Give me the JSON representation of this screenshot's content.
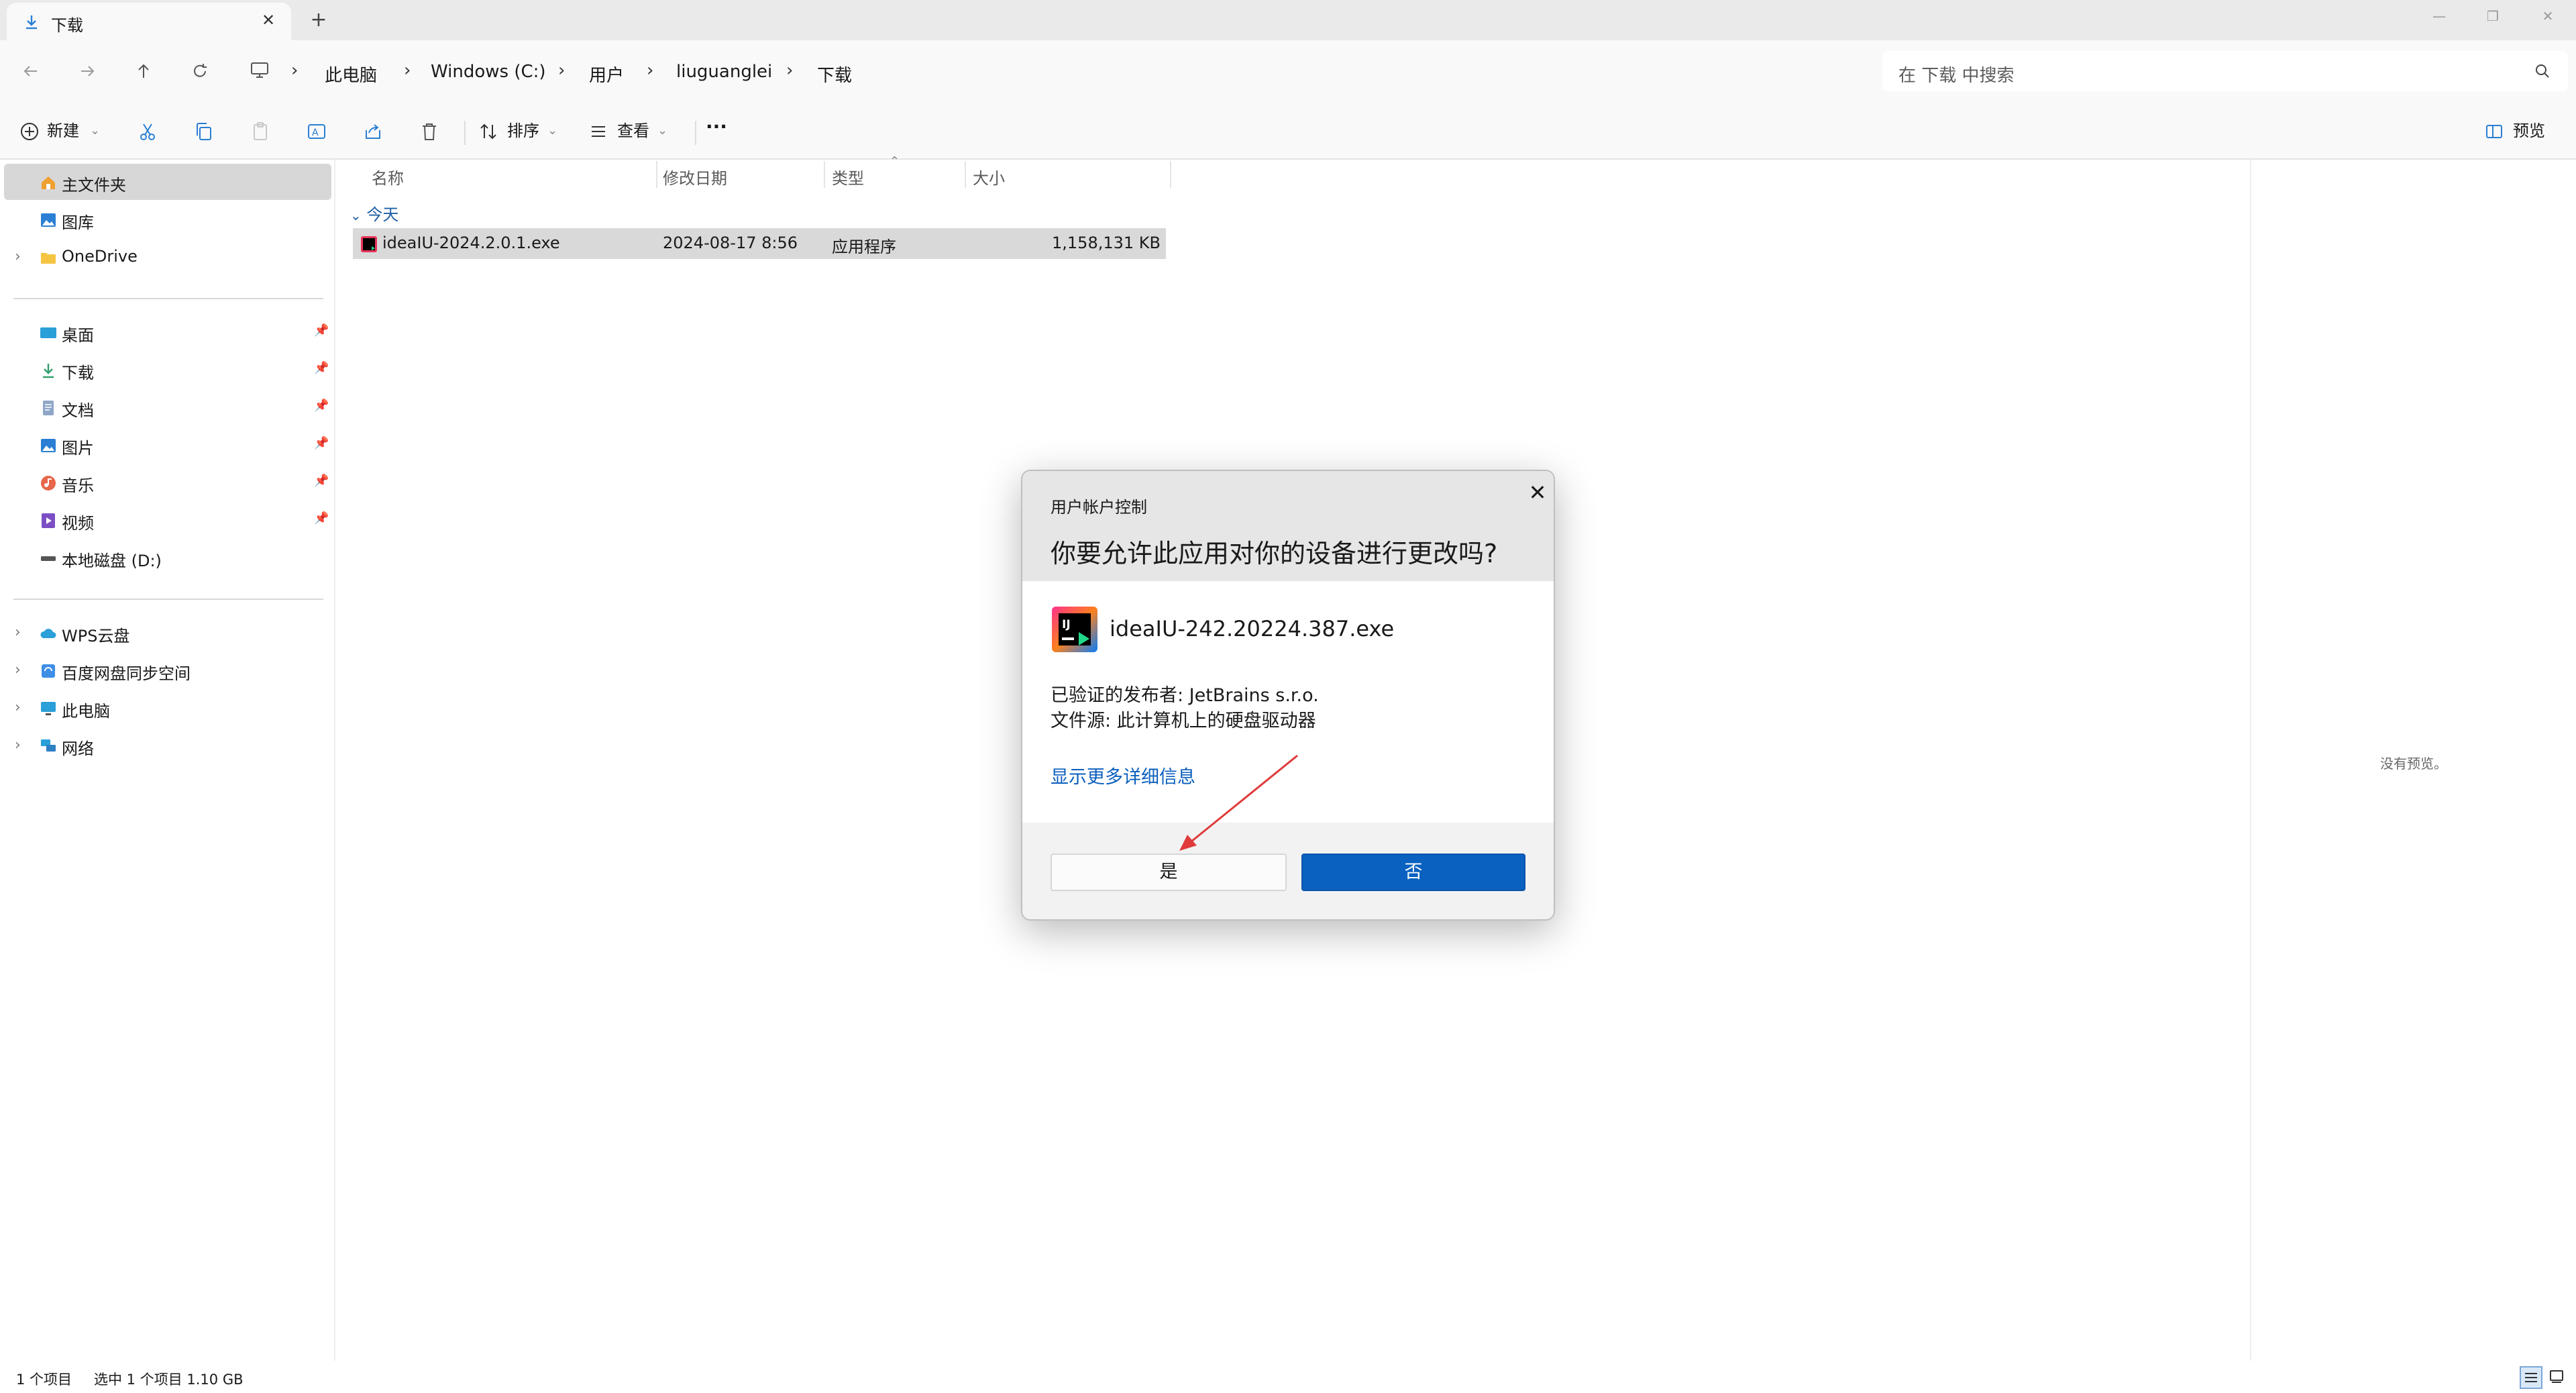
{
  "tab": {
    "title": "下载",
    "close_glyph": "✕",
    "new_glyph": "+"
  },
  "window_controls": {
    "minimize": "—",
    "restore": "❐",
    "close": "✕"
  },
  "breadcrumb": [
    "此电脑",
    "Windows (C:)",
    "用户",
    "liuguanglei",
    "下载"
  ],
  "search": {
    "placeholder": "在 下载 中搜索"
  },
  "toolbar": {
    "new_label": "新建",
    "sort_label": "排序",
    "view_label": "查看",
    "more_label": "···",
    "preview_label": "预览"
  },
  "sidebar": {
    "top": [
      {
        "label": "主文件夹",
        "icon": "home-icon",
        "selected": true
      },
      {
        "label": "图库",
        "icon": "gallery-icon"
      },
      {
        "label": "OneDrive",
        "icon": "folder-icon",
        "expandable": true
      }
    ],
    "pinned": [
      {
        "label": "桌面",
        "icon": "desktop-icon"
      },
      {
        "label": "下载",
        "icon": "download-icon"
      },
      {
        "label": "文档",
        "icon": "document-icon"
      },
      {
        "label": "图片",
        "icon": "pictures-icon"
      },
      {
        "label": "音乐",
        "icon": "music-icon"
      },
      {
        "label": "视频",
        "icon": "video-icon"
      },
      {
        "label": "本地磁盘 (D:)",
        "icon": "drive-icon"
      }
    ],
    "bottom": [
      {
        "label": "WPS云盘",
        "icon": "cloud-icon"
      },
      {
        "label": "百度网盘同步空间",
        "icon": "baidu-sync-icon"
      },
      {
        "label": "此电脑",
        "icon": "computer-icon"
      },
      {
        "label": "网络",
        "icon": "network-icon"
      }
    ]
  },
  "columns": [
    "名称",
    "修改日期",
    "类型",
    "大小"
  ],
  "group_label": "今天",
  "files": [
    {
      "name": "ideaIU-2024.2.0.1.exe",
      "modified": "2024-08-17 8:56",
      "type": "应用程序",
      "size": "1,158,131 KB"
    }
  ],
  "preview": {
    "empty_text": "没有预览。"
  },
  "status": {
    "count": "1 个项目",
    "selection": "选中 1 个项目  1.10 GB"
  },
  "uac": {
    "title": "用户帐户控制",
    "question": "你要允许此应用对你的设备进行更改吗?",
    "app_name": "ideaIU-242.20224.387.exe",
    "publisher": "已验证的发布者: JetBrains s.r.o.",
    "source": "文件源: 此计算机上的硬盘驱动器",
    "more_link": "显示更多详细信息",
    "yes": "是",
    "no": "否",
    "close_glyph": "✕"
  },
  "colors": {
    "accent": "#0a61bf",
    "link": "#0a5fbd",
    "annotation_arrow": "#e03a3a"
  }
}
